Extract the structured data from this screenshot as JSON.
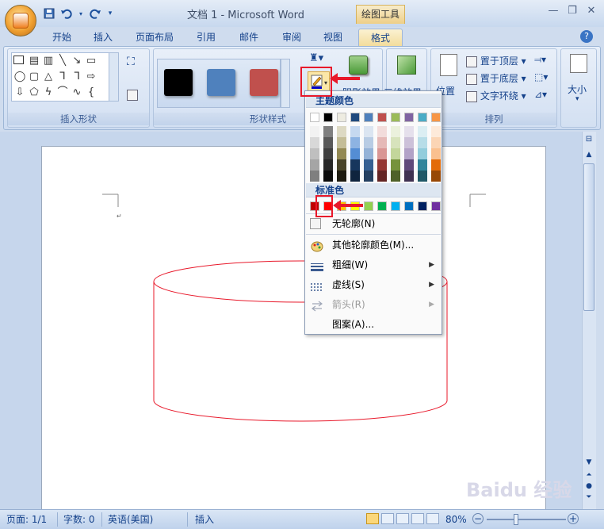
{
  "window": {
    "title": "文档 1 - Microsoft Word",
    "context_tab_group": "绘图工具",
    "help_icon": "?"
  },
  "quick_access": {
    "icons": [
      "save-icon",
      "undo-icon",
      "redo-icon",
      "customize-qat-icon"
    ]
  },
  "tabs": [
    "开始",
    "插入",
    "页面布局",
    "引用",
    "邮件",
    "审阅",
    "视图",
    "格式"
  ],
  "active_tab": "格式",
  "ribbon": {
    "group_insert_shapes": "插入形状",
    "group_shape_styles": "形状样式",
    "group_arrange": "排列",
    "shadow_effects": "阴影效果",
    "three_d_effects": "三维效果",
    "position": "位置",
    "bring_to_front": "置于顶层",
    "send_to_back": "置于底层",
    "text_wrap": "文字环绕",
    "size": "大小",
    "style_colors": [
      "#000000",
      "#4f81bd",
      "#c0504d"
    ]
  },
  "dropdown": {
    "theme_colors_title": "主题颜色",
    "standard_colors_title": "标准色",
    "theme_top_row": [
      "#ffffff",
      "#000000",
      "#eeece1",
      "#1f497d",
      "#4f81bd",
      "#c0504d",
      "#9bbb59",
      "#8064a2",
      "#4bacc6",
      "#f79646"
    ],
    "theme_shades": [
      [
        "#f2f2f2",
        "#d8d8d8",
        "#bfbfbf",
        "#a5a5a5",
        "#7f7f7f"
      ],
      [
        "#7f7f7f",
        "#595959",
        "#3f3f3f",
        "#262626",
        "#0c0c0c"
      ],
      [
        "#ddd9c3",
        "#c4bd97",
        "#938953",
        "#494429",
        "#1d1b10"
      ],
      [
        "#c6d9f0",
        "#8db3e2",
        "#548dd4",
        "#17365d",
        "#0f243e"
      ],
      [
        "#dbe5f1",
        "#b8cce4",
        "#95b3d7",
        "#366092",
        "#244061"
      ],
      [
        "#f2dcdb",
        "#e5b9b7",
        "#d99694",
        "#953734",
        "#632423"
      ],
      [
        "#ebf1dd",
        "#d7e3bc",
        "#c3d69b",
        "#76923c",
        "#4f6128"
      ],
      [
        "#e5e0ec",
        "#ccc1d9",
        "#b2a2c7",
        "#5f497a",
        "#3f3151"
      ],
      [
        "#dbeef3",
        "#b7dde8",
        "#92cddc",
        "#31859b",
        "#205867"
      ],
      [
        "#fdeada",
        "#fbd5b5",
        "#fac08f",
        "#e36c09",
        "#974806"
      ]
    ],
    "standard_colors": [
      "#c00000",
      "#ff0000",
      "#ffc000",
      "#ffff00",
      "#92d050",
      "#00b050",
      "#00b0f0",
      "#0070c0",
      "#002060",
      "#7030a0"
    ],
    "no_outline": "无轮廓(N)",
    "more_colors": "其他轮廓颜色(M)...",
    "weight": "粗细(W)",
    "dashes": "虚线(S)",
    "arrows": "箭头(R)",
    "pattern": "图案(A)..."
  },
  "shape": {
    "stroke_color": "#e8182a",
    "type": "cylinder"
  },
  "statusbar": {
    "page": "页面: 1/1",
    "words": "字数: 0",
    "language": "英语(美国)",
    "mode": "插入",
    "zoom": "80%"
  },
  "watermark": "Baidu 经验"
}
